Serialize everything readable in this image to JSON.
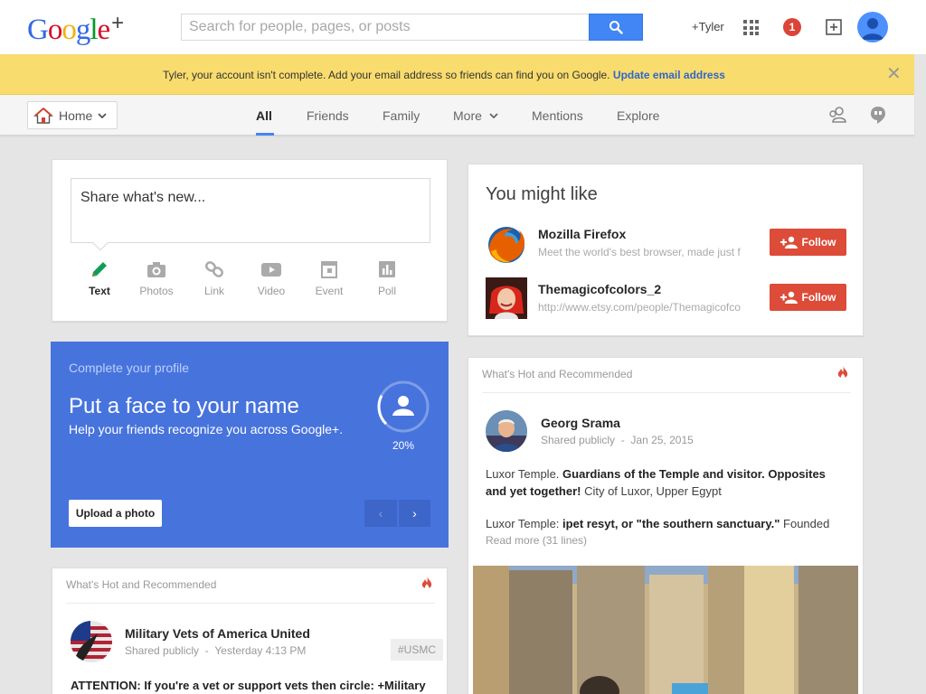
{
  "header": {
    "logo": {
      "letters": [
        "G",
        "o",
        "o",
        "g",
        "l",
        "e"
      ],
      "plus": "+"
    },
    "search_placeholder": "Search for people, pages, or posts",
    "user_link": "+Tyler",
    "notification_count": "1"
  },
  "banner": {
    "message": "Tyler, your account isn't complete. Add your email address so friends can find you on Google.",
    "link": "Update email address",
    "close": "✕"
  },
  "nav": {
    "home_label": "Home",
    "tabs": [
      "All",
      "Friends",
      "Family",
      "More",
      "Mentions",
      "Explore"
    ],
    "active_tab": "All"
  },
  "share": {
    "placeholder": "Share what's new...",
    "options": [
      "Text",
      "Photos",
      "Link",
      "Video",
      "Event",
      "Poll"
    ]
  },
  "profile_prompt": {
    "kicker": "Complete your profile",
    "title": "Put a face to your name",
    "subtitle": "Help your friends recognize you across Google+.",
    "progress_label": "20%",
    "progress": 0.2,
    "upload_label": "Upload a photo",
    "prev": "‹",
    "next": "›"
  },
  "hot_left": {
    "header": "What's Hot and Recommended",
    "author": "Military Vets of America United",
    "visibility": "Shared publicly",
    "date": "Yesterday 4:13 PM",
    "hashtag": "#USMC",
    "text": "ATTENTION: If you're a vet or support vets then circle: +Military"
  },
  "you_might_like": {
    "title": "You might like",
    "items": [
      {
        "name": "Mozilla Firefox",
        "desc": "Meet the world's best browser, made just f",
        "follow": "Follow"
      },
      {
        "name": "Themagicofcolors_2",
        "desc": "http://www.etsy.com/people/Themagicofco",
        "follow": "Follow"
      }
    ]
  },
  "hot_right": {
    "header": "What's Hot and Recommended",
    "author": "Georg Srama",
    "visibility": "Shared publicly",
    "date": "Jan 25, 2015",
    "p1_prefix": "Luxor Temple. ",
    "p1_bold": "Guardians of the Temple and visitor. Opposites and yet together!",
    "p1_suffix": " City of Luxor, Upper Egypt",
    "p2_prefix": "Luxor Temple: ",
    "p2_bold": "ipet resyt, or \"the southern sanctuary.\"",
    "p2_suffix": " Founded",
    "read_more": "Read more (31 lines)"
  },
  "colors": {
    "google_blue": "#4285f4",
    "banner_yellow": "#f9dc6e",
    "profile_blue": "#4773dd",
    "follow_red": "#dd4b39",
    "notif_red": "#db4437"
  }
}
